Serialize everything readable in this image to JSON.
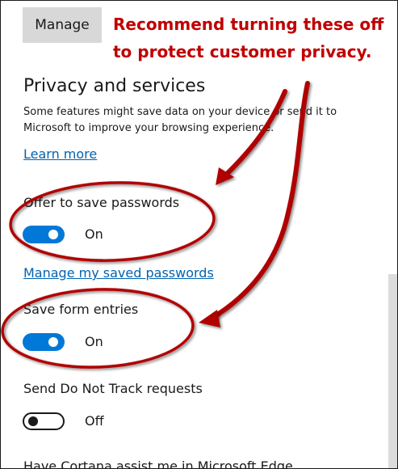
{
  "manage_tab": "Manage",
  "callout": {
    "line1": "Recommend turning these off",
    "line2": "to protect customer privacy."
  },
  "section": {
    "heading": "Privacy and services",
    "description": "Some features might save data on your device or send it to Microsoft to improve your browsing experience.",
    "learn_more": "Learn more"
  },
  "settings": [
    {
      "label": "Offer to save passwords",
      "state": "On"
    },
    {
      "label": "Save form entries",
      "state": "On"
    },
    {
      "label": "Send Do Not Track requests",
      "state": "Off"
    },
    {
      "label": "Have Cortana assist me in Microsoft Edge"
    }
  ],
  "manage_passwords_link": "Manage my saved passwords",
  "colors": {
    "accent": "#0078d7",
    "link": "#0063b1",
    "annotation": "#c00000"
  }
}
